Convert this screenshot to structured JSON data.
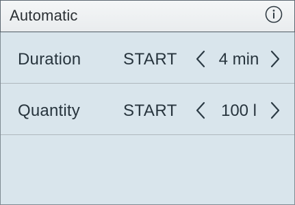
{
  "header": {
    "title": "Automatic",
    "info_icon": "info-icon"
  },
  "rows": [
    {
      "label": "Duration",
      "mode": "START",
      "value": "4 min"
    },
    {
      "label": "Quantity",
      "mode": "START",
      "value": "100 l"
    }
  ],
  "colors": {
    "background": "#dde7ed",
    "header": "#eef1f3",
    "text": "#27343d",
    "divider": "#aeb7bd"
  }
}
